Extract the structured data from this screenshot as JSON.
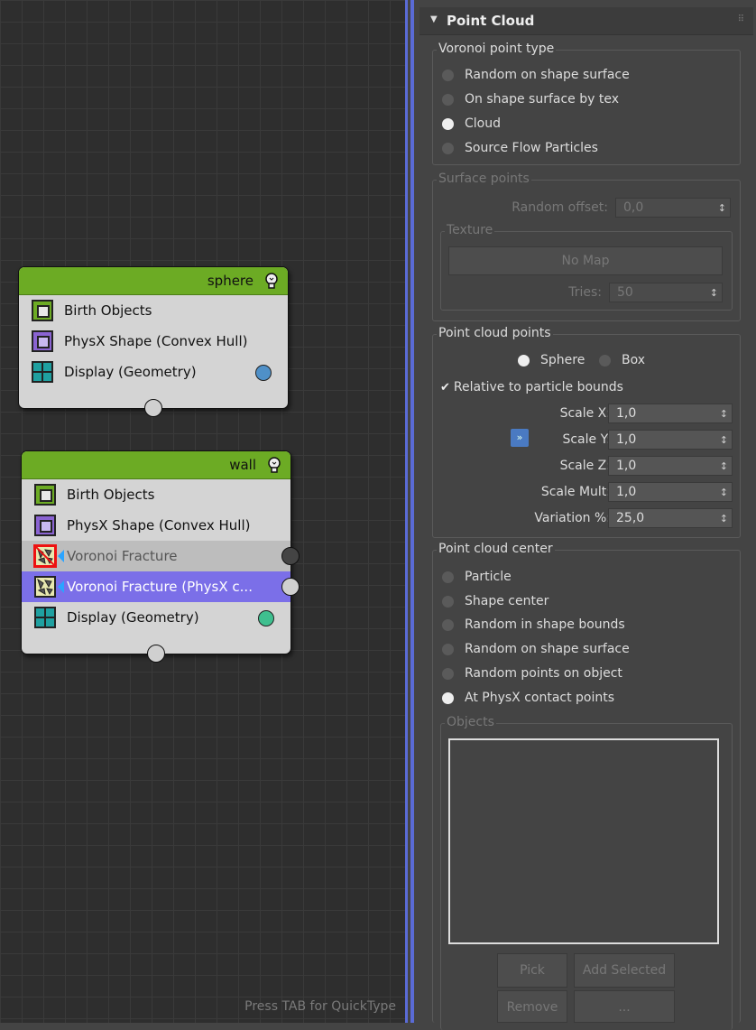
{
  "graph": {
    "hint": "Press TAB for QuickType",
    "nodes": [
      {
        "title": "sphere",
        "operators": [
          {
            "label": "Birth Objects",
            "icon": "birth-icon"
          },
          {
            "label": "PhysX Shape (Convex Hull)",
            "icon": "physx-shape-icon"
          },
          {
            "label": "Display (Geometry)",
            "icon": "display-icon",
            "dot_color": "#4f90c8"
          }
        ]
      },
      {
        "title": "wall",
        "operators": [
          {
            "label": "Birth Objects",
            "icon": "birth-icon"
          },
          {
            "label": "PhysX Shape (Convex Hull)",
            "icon": "physx-shape-icon"
          },
          {
            "label": "Voronoi Fracture",
            "icon": "voronoi-icon",
            "state": "disabled"
          },
          {
            "label": "Voronoi Fracture (PhysX c...",
            "icon": "voronoi-icon",
            "state": "selected"
          },
          {
            "label": "Display (Geometry)",
            "icon": "display-icon",
            "dot_color": "#3fbf8f"
          }
        ]
      }
    ]
  },
  "panel": {
    "rollout_title": "Point Cloud",
    "voronoi_type": {
      "title": "Voronoi point type",
      "options": [
        "Random on shape surface",
        "On shape surface by tex",
        "Cloud",
        "Source Flow Particles"
      ],
      "selected": "Cloud"
    },
    "surface_points": {
      "title": "Surface points",
      "random_offset_label": "Random offset:",
      "random_offset_value": "0,0",
      "texture_title": "Texture",
      "no_map_label": "No Map",
      "tries_label": "Tries:",
      "tries_value": "50"
    },
    "point_cloud_points": {
      "title": "Point cloud points",
      "shape_options": [
        "Sphere",
        "Box"
      ],
      "shape_selected": "Sphere",
      "relative_label": "Relative to particle bounds",
      "relative_checked": true,
      "expand_glyph": "»",
      "fields": [
        {
          "label": "Scale X:",
          "value": "1,0"
        },
        {
          "label": "Scale Y:",
          "value": "1,0"
        },
        {
          "label": "Scale Z:",
          "value": "1,0"
        },
        {
          "label": "Scale Mult:",
          "value": "1,0"
        },
        {
          "label": "Variation %:",
          "value": "25,0"
        }
      ]
    },
    "point_cloud_center": {
      "title": "Point cloud center",
      "options": [
        "Particle",
        "Shape center",
        "Random in shape bounds",
        "Random on shape surface",
        "Random points on object",
        "At PhysX contact points"
      ],
      "selected": "At PhysX contact points",
      "objects_title": "Objects",
      "pick_label": "Pick",
      "add_selected_label": "Add Selected",
      "remove_label": "Remove",
      "more_label": "..."
    }
  }
}
